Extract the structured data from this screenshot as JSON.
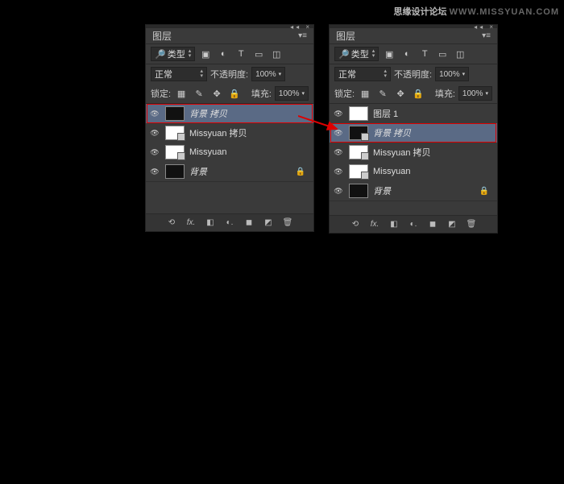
{
  "watermark": {
    "brand": "思缘设计论坛",
    "url": "WWW.MISSYUAN.COM"
  },
  "panel": {
    "title": "图层",
    "filter_label": "类型",
    "blend_mode": "正常",
    "opacity_label": "不透明度:",
    "opacity_value": "100%",
    "lock_label": "锁定:",
    "fill_label": "填充:",
    "fill_value": "100%"
  },
  "left_layers": [
    {
      "name": "背景 拷贝",
      "thumb": "black",
      "selected": true,
      "locked": false
    },
    {
      "name": "Missyuan 拷贝",
      "thumb": "white",
      "selected": false,
      "locked": false
    },
    {
      "name": "Missyuan",
      "thumb": "white",
      "selected": false,
      "locked": false
    },
    {
      "name": "背景",
      "thumb": "black",
      "selected": false,
      "locked": true
    }
  ],
  "right_layers": [
    {
      "name": "图层 1",
      "thumb": "white",
      "selected": false,
      "locked": false
    },
    {
      "name": "背景 拷贝",
      "thumb": "black",
      "selected": true,
      "locked": false
    },
    {
      "name": "Missyuan 拷贝",
      "thumb": "white",
      "selected": false,
      "locked": false
    },
    {
      "name": "Missyuan",
      "thumb": "white",
      "selected": false,
      "locked": false
    },
    {
      "name": "背景",
      "thumb": "black",
      "selected": false,
      "locked": true
    }
  ],
  "footer_icons": [
    "⟲",
    "fx.",
    "◧",
    "◐",
    "▧",
    "◼",
    "◩",
    "🗑"
  ]
}
